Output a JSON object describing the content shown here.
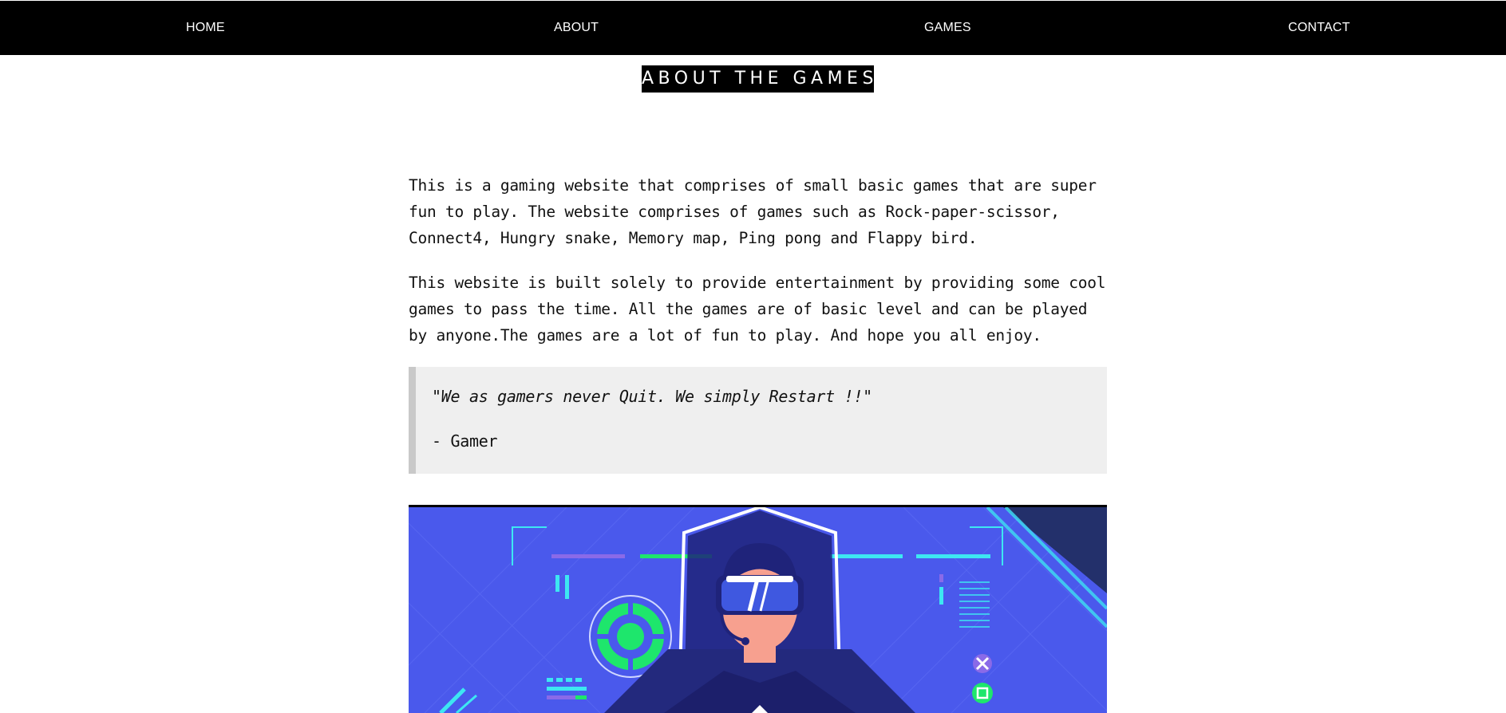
{
  "nav": {
    "items": [
      {
        "label": "HOME"
      },
      {
        "label": "ABOUT"
      },
      {
        "label": "GAMES"
      },
      {
        "label": "CONTACT"
      }
    ]
  },
  "page": {
    "title": "ABOUT THE GAMES",
    "paragraphs": [
      "This is a gaming website that comprises of small basic games that are super fun to play. The website comprises of games such as Rock-paper-scissor, Connect4, Hungry snake, Memory map, Ping pong and Flappy bird.",
      "This website is built solely to provide entertainment by providing some cool games to pass the time. All the games are of basic level and can be played by anyone.The games are a lot of fun to play. And hope you all enjoy."
    ],
    "quote": {
      "text": "\"We as gamers never Quit. We simply Restart !!\"",
      "author": "- Gamer"
    }
  },
  "hero_image": {
    "subject": "vr-gamer-illustration",
    "colors": {
      "background": "#4a59ec",
      "accent_green": "#1ee66c",
      "accent_cyan": "#3de7f2",
      "dark_navy": "#1f237a",
      "skin": "#f7a08f"
    }
  }
}
